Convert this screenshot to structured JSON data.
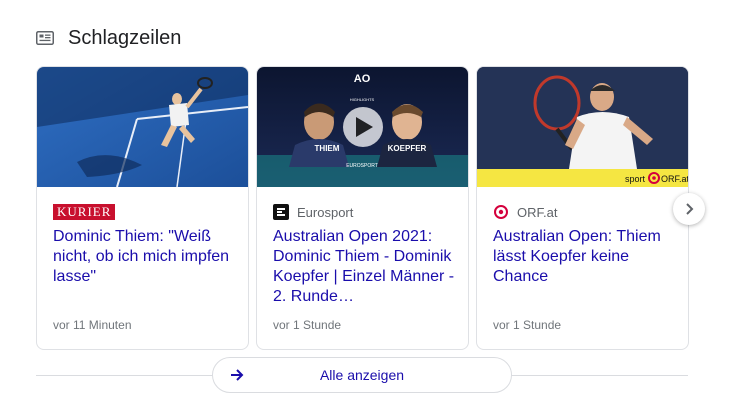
{
  "header": {
    "title": "Schlagzeilen",
    "icon": "news-icon"
  },
  "cards": [
    {
      "source": "KURIER",
      "source_color": "#c8102e",
      "headline": "Dominic Thiem: \"Weiß nicht, ob ich mich impfen lasse\"",
      "time": "vor 11 Minuten"
    },
    {
      "source": "Eurosport",
      "headline": "Australian Open 2021: Dominic Thiem - Dominik Koepfer | Einzel Männer - 2. Runde…",
      "time": "vor 1 Stunde",
      "thumb_texts": {
        "ao": "AO",
        "highlights": "HIGHLIGHTS",
        "player1": "THIEM",
        "player2": "KOEPFER",
        "network": "EUROSPORT"
      }
    },
    {
      "source": "ORF.at",
      "headline": "Australian Open: Thiem lässt Koepfer keine Chance",
      "time": "vor 1 Stunde",
      "thumb_texts": {
        "brand_left": "sport",
        "brand_right": "ORF.at"
      }
    }
  ],
  "show_all": {
    "label": "Alle anzeigen"
  },
  "colors": {
    "link": "#1a0dab",
    "meta": "#70757a",
    "border": "#dfe1e5",
    "orf_yellow": "#f5e642",
    "orf_red": "#d4003c"
  }
}
